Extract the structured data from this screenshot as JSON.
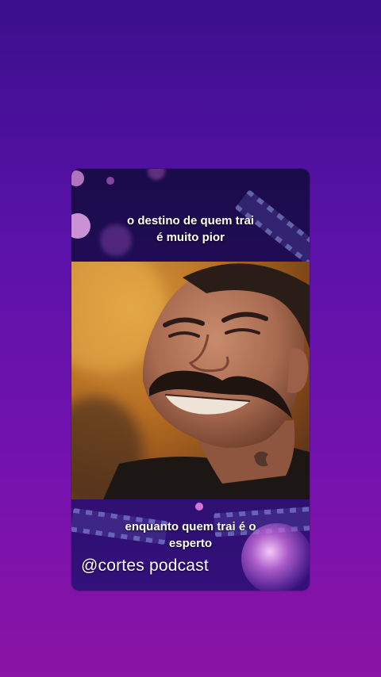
{
  "captions": {
    "top": {
      "line1": "o destino de quem trai",
      "line2": "é muito pior"
    },
    "bottom": {
      "line1": "enquanto quem trai é o",
      "line2": "esperto"
    }
  },
  "watermark": "@cortes podcast",
  "colors": {
    "page_top": "#3a0f8c",
    "page_bottom": "#8a14a4",
    "card_bg": "#2b0f6b",
    "caption_text": "#ffffff"
  }
}
